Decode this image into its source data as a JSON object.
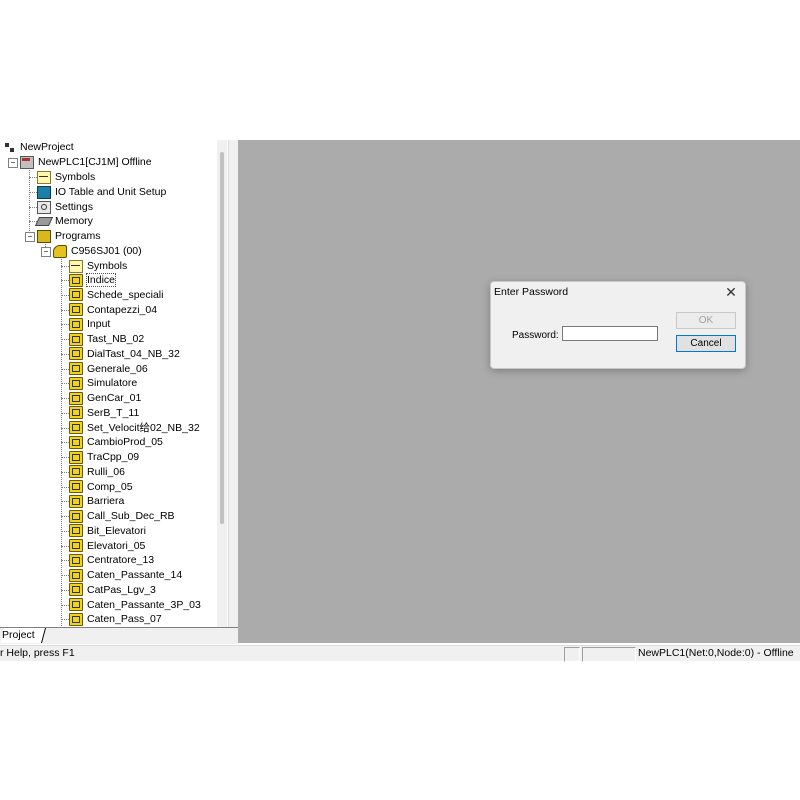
{
  "tree": {
    "root": "NewProject",
    "plc": "NewPLC1[CJ1M] Offline",
    "plc_children": [
      "Symbols",
      "IO Table and Unit Setup",
      "Settings",
      "Memory",
      "Programs"
    ],
    "task": "C956SJ01 (00)",
    "task_symbols": "Symbols",
    "sections": [
      "Indice",
      "Schede_speciali",
      "Contapezzi_04",
      "Input",
      "Tast_NB_02",
      "DialTast_04_NB_32",
      "Generale_06",
      "Simulatore",
      "GenCar_01",
      "SerB_T_11",
      "Set_Velocit给02_NB_32",
      "CambioProd_05",
      "TraCpp_09",
      "Rulli_06",
      "Comp_05",
      "Barriera",
      "Call_Sub_Dec_RB",
      "Bit_Elevatori",
      "Elevatori_05",
      "Centratore_13",
      "Caten_Passante_14",
      "CatPas_Lgv_3",
      "Caten_Passante_3P_03",
      "Caten_Pass_07"
    ]
  },
  "tab": {
    "project_label": "Project"
  },
  "status": {
    "help_text": "r Help, press F1",
    "plc_status": "NewPLC1(Net:0,Node:0) - Offline"
  },
  "dialog": {
    "title": "Enter Password",
    "close_glyph": "✕",
    "password_label": "Password:",
    "password_value": "",
    "ok_label": "OK",
    "cancel_label": "Cancel"
  }
}
